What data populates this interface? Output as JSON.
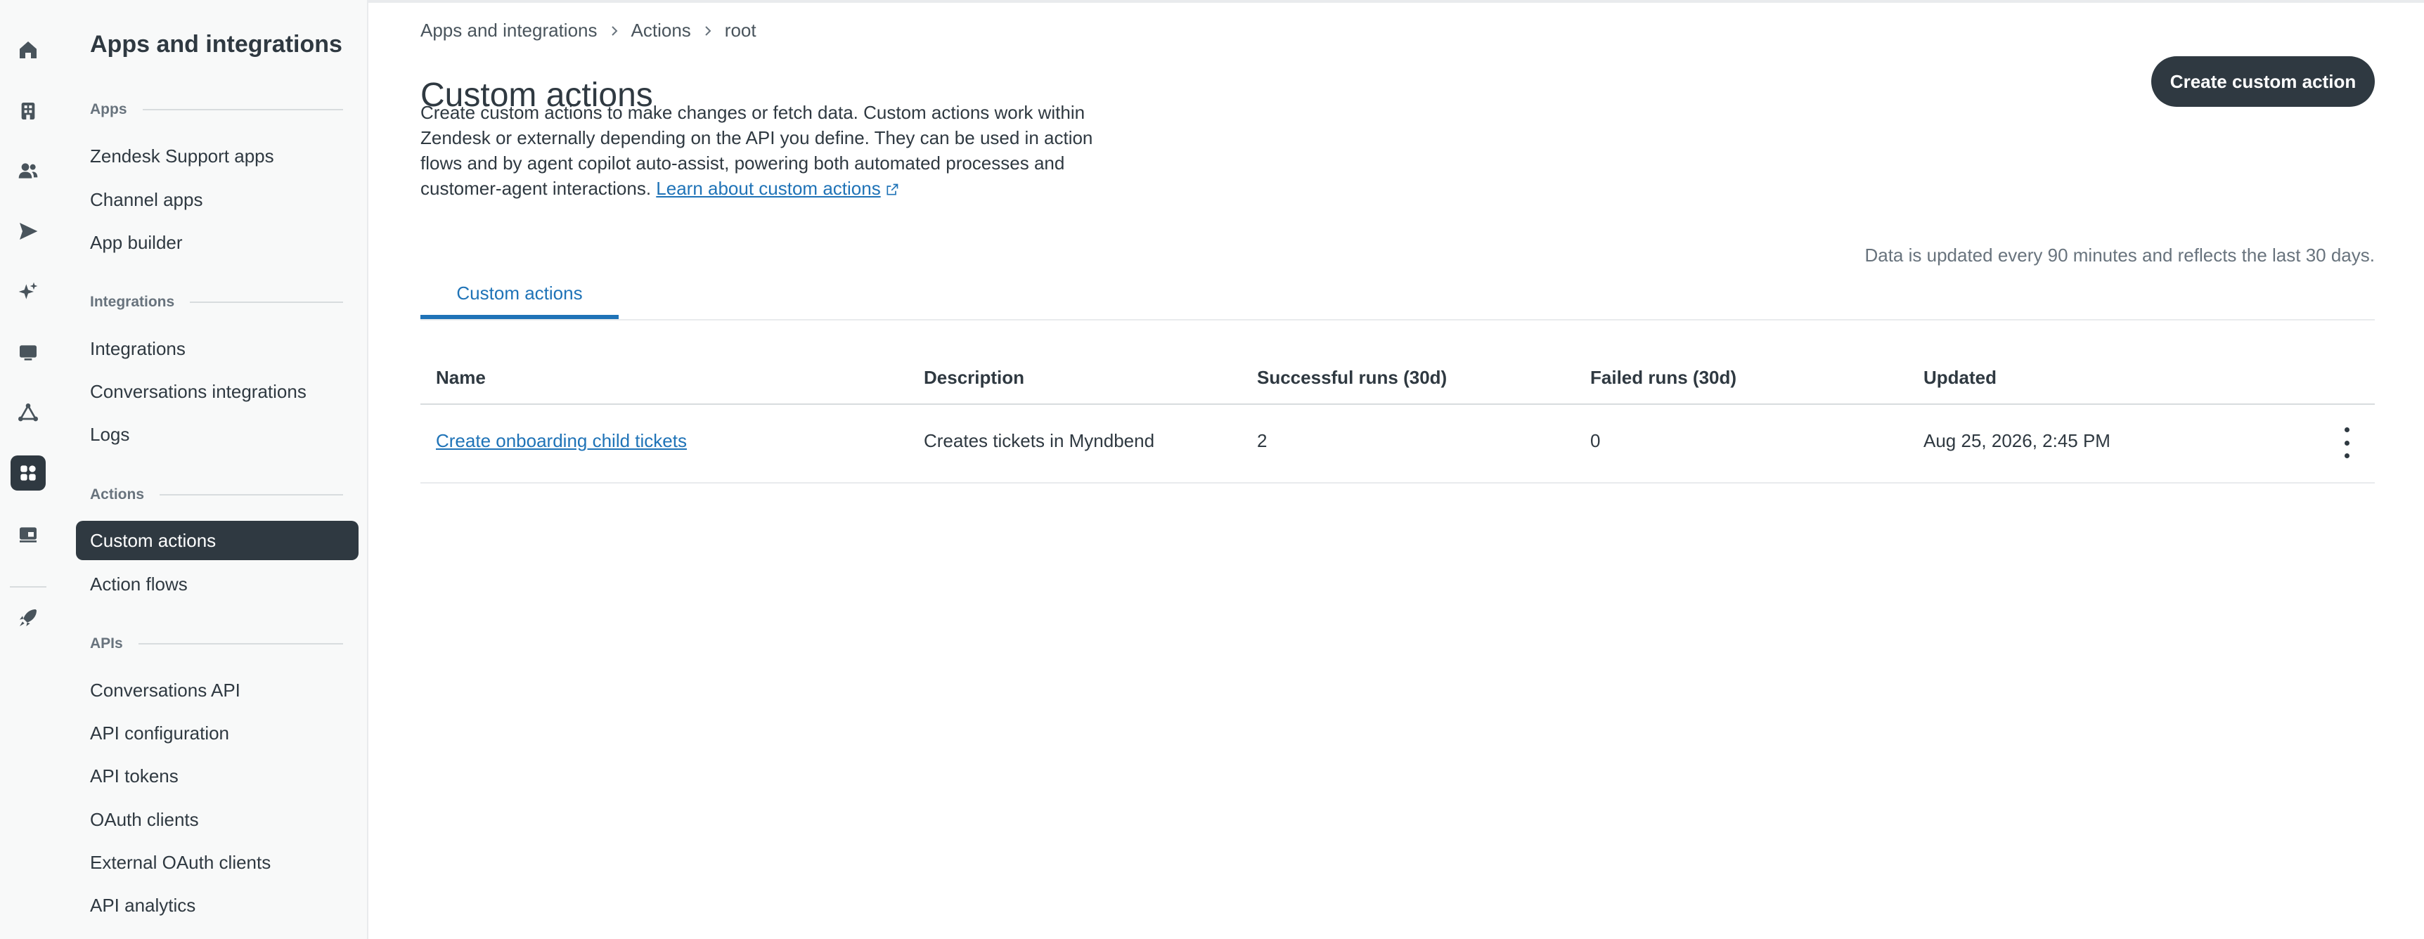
{
  "rail": {
    "icons": [
      "home-icon",
      "building-icon",
      "people-icon",
      "send-icon",
      "sparkle-icon",
      "monitor-icon",
      "network-icon",
      "apps-icon",
      "workspace-icon",
      "rocket-icon"
    ],
    "active": "apps-icon"
  },
  "sidebar": {
    "title": "Apps and integrations",
    "sections": [
      {
        "label": "Apps",
        "items": [
          "Zendesk Support apps",
          "Channel apps",
          "App builder"
        ]
      },
      {
        "label": "Integrations",
        "items": [
          "Integrations",
          "Conversations integrations",
          "Logs"
        ]
      },
      {
        "label": "Actions",
        "items": [
          "Custom actions",
          "Action flows"
        ]
      },
      {
        "label": "APIs",
        "items": [
          "Conversations API",
          "API configuration",
          "API tokens",
          "OAuth clients",
          "External OAuth clients",
          "API analytics"
        ]
      }
    ],
    "active_item": "Custom actions"
  },
  "breadcrumb": [
    "Apps and integrations",
    "Actions",
    "root"
  ],
  "page": {
    "title": "Custom actions",
    "description": "Create custom actions to make changes or fetch data. Custom actions work within Zendesk or externally depending on the API you define. They can be used in action flows and by agent copilot auto-assist, powering both automated processes and customer-agent interactions.",
    "learn_link": "Learn about custom actions",
    "create_button": "Create custom action",
    "update_note": "Data is updated every 90 minutes and reflects the last 30 days.",
    "tab": "Custom actions"
  },
  "table": {
    "headers": [
      "Name",
      "Description",
      "Successful runs (30d)",
      "Failed runs (30d)",
      "Updated"
    ],
    "rows": [
      {
        "name": "Create onboarding child tickets",
        "description": "Creates tickets in Myndbend",
        "successful": "2",
        "failed": "0",
        "updated": "Aug 25, 2026, 2:45 PM"
      }
    ]
  },
  "colors": {
    "accent": "#1f73b7",
    "dark": "#2f3941",
    "muted": "#68737d"
  }
}
